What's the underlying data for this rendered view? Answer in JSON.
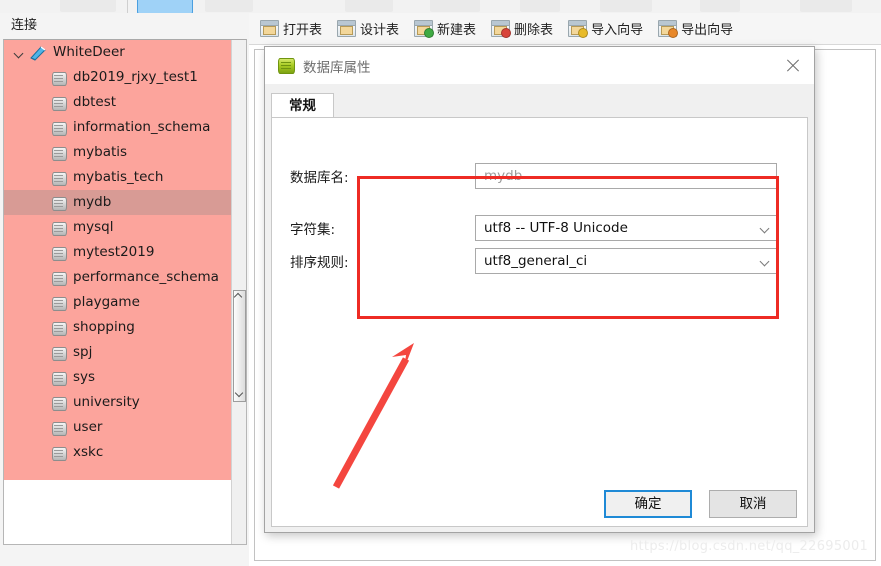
{
  "top_strip": {
    "selected_button_present": true
  },
  "connections_panel": {
    "header": "连接",
    "tree": {
      "root": {
        "label": "WhiteDeer",
        "icon": "connection-icon",
        "expanded": true
      },
      "databases": [
        {
          "label": "db2019_rjxy_test1",
          "selected": false
        },
        {
          "label": "dbtest",
          "selected": false
        },
        {
          "label": "information_schema",
          "selected": false
        },
        {
          "label": "mybatis",
          "selected": false
        },
        {
          "label": "mybatis_tech",
          "selected": false
        },
        {
          "label": "mydb",
          "selected": true
        },
        {
          "label": "mysql",
          "selected": false
        },
        {
          "label": "mytest2019",
          "selected": false
        },
        {
          "label": "performance_schema",
          "selected": false
        },
        {
          "label": "playgame",
          "selected": false
        },
        {
          "label": "shopping",
          "selected": false
        },
        {
          "label": "spj",
          "selected": false
        },
        {
          "label": "sys",
          "selected": false
        },
        {
          "label": "university",
          "selected": false
        },
        {
          "label": "user",
          "selected": false
        },
        {
          "label": "xskc",
          "selected": false
        }
      ]
    },
    "colors": {
      "tree_background": "#fca49c",
      "selected_row": "#d89b95"
    }
  },
  "toolbar": {
    "items": [
      {
        "label": "打开表",
        "icon": "open-table-icon",
        "badge": ""
      },
      {
        "label": "设计表",
        "icon": "design-table-icon",
        "badge": ""
      },
      {
        "label": "新建表",
        "icon": "new-table-icon",
        "badge": "#3faa42"
      },
      {
        "label": "删除表",
        "icon": "delete-table-icon",
        "badge": "#d8443a"
      },
      {
        "label": "导入向导",
        "icon": "import-wizard-icon",
        "badge": "#e8bb2a"
      },
      {
        "label": "导出向导",
        "icon": "export-wizard-icon",
        "badge": "#e8882a"
      }
    ]
  },
  "dialog": {
    "title": "数据库属性",
    "icon": "database-icon",
    "close_icon": "close-icon",
    "tabs": [
      {
        "label": "常规",
        "active": true
      }
    ],
    "fields": {
      "db_name": {
        "label": "数据库名:",
        "value": "",
        "placeholder": "mydb"
      },
      "charset": {
        "label": "字符集:",
        "value": "utf8 -- UTF-8 Unicode"
      },
      "collation": {
        "label": "排序规则:",
        "value": "utf8_general_ci"
      }
    },
    "buttons": {
      "ok": "确定",
      "cancel": "取消"
    }
  },
  "annotations": {
    "highlight_rect_color": "#ee2b24",
    "arrow_color": "#f4463f"
  },
  "watermark": "https://blog.csdn.net/qq_22695001"
}
